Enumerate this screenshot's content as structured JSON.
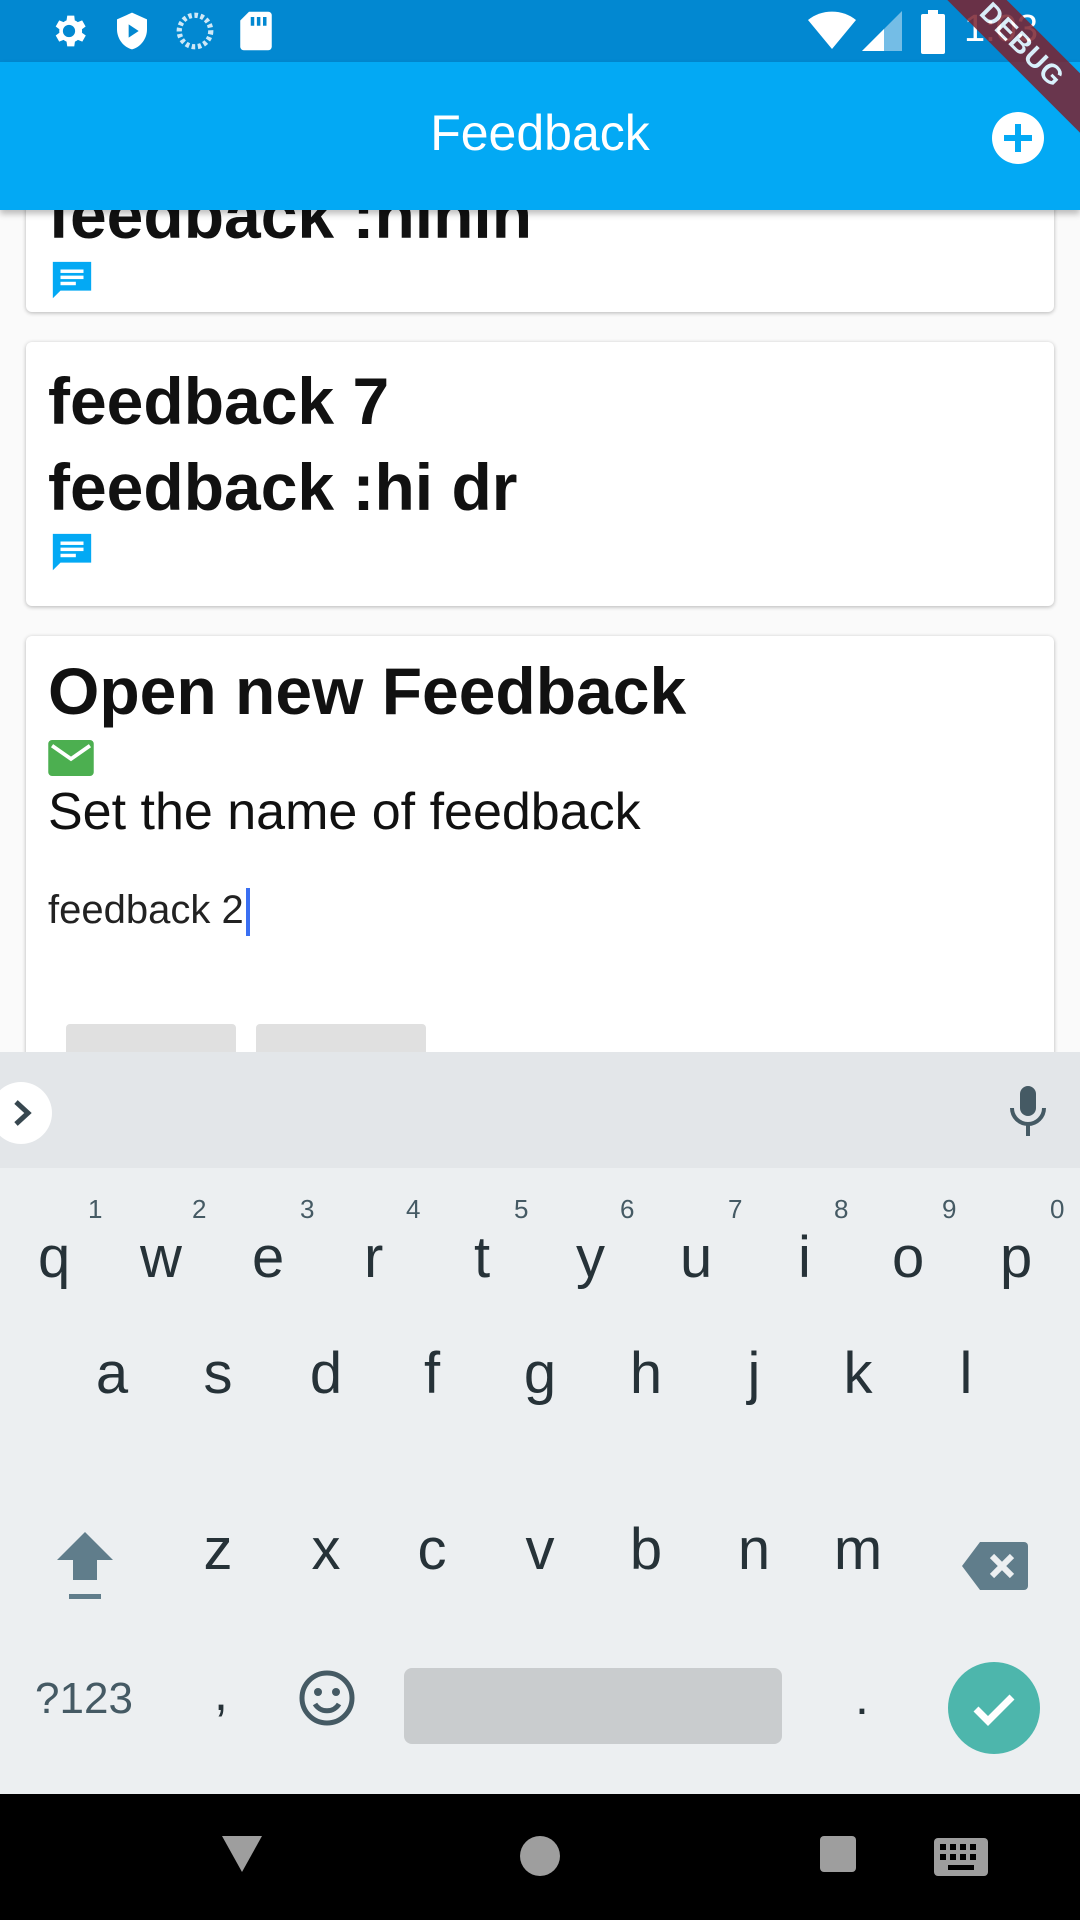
{
  "status_bar": {
    "time": "1:03",
    "icons": [
      "settings-icon",
      "shield-play-icon",
      "sync-icon",
      "sd-card-icon",
      "wifi-icon",
      "signal-icon",
      "battery-icon"
    ]
  },
  "app_bar": {
    "title": "Feedback",
    "add_icon": "add-circle-icon",
    "debug_banner": "DEBUG"
  },
  "cards": [
    {
      "lines": [
        "feedback :hihih"
      ],
      "icon": "chat-icon"
    },
    {
      "lines": [
        "feedback 7",
        "feedback :hi dr"
      ],
      "icon": "chat-icon"
    }
  ],
  "dialog": {
    "title": "Open new Feedback",
    "icon": "mail-icon",
    "prompt": "Set the name of feedback",
    "input_value": "feedback 2"
  },
  "keyboard": {
    "row1": [
      {
        "letter": "q",
        "hint": "1"
      },
      {
        "letter": "w",
        "hint": "2"
      },
      {
        "letter": "e",
        "hint": "3"
      },
      {
        "letter": "r",
        "hint": "4"
      },
      {
        "letter": "t",
        "hint": "5"
      },
      {
        "letter": "y",
        "hint": "6"
      },
      {
        "letter": "u",
        "hint": "7"
      },
      {
        "letter": "i",
        "hint": "8"
      },
      {
        "letter": "o",
        "hint": "9"
      },
      {
        "letter": "p",
        "hint": "0"
      }
    ],
    "row2": [
      "a",
      "s",
      "d",
      "f",
      "g",
      "h",
      "j",
      "k",
      "l"
    ],
    "row3": [
      "z",
      "x",
      "c",
      "v",
      "b",
      "n",
      "m"
    ],
    "symbols_label": "?123",
    "comma": ",",
    "period": "."
  },
  "colors": {
    "status_bar": "#0288d1",
    "app_bar": "#03a9f4",
    "chat_icon": "#03a9f4",
    "mail_icon": "#4caf50",
    "enter_key": "#4db6ac",
    "caret": "#3a6ff2"
  }
}
